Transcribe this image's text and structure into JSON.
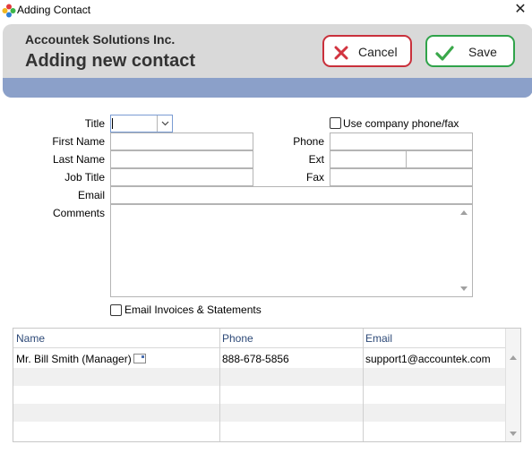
{
  "window": {
    "title": "Adding Contact",
    "close_glyph": "✕",
    "icon": "pinwheel-app-icon"
  },
  "header": {
    "company": "Accountek Solutions Inc.",
    "title": "Adding new contact",
    "cancel_label": "Cancel",
    "save_label": "Save",
    "cancel_color": "#c9303b",
    "save_color": "#2fa34a",
    "strip_color": "#8ba0c9"
  },
  "form": {
    "title_label": "Title",
    "title_value": "",
    "first_name_label": "First Name",
    "first_name_value": "",
    "last_name_label": "Last Name",
    "last_name_value": "",
    "job_title_label": "Job Title",
    "job_title_value": "",
    "email_label": "Email",
    "email_value": "",
    "comments_label": "Comments",
    "comments_value": "",
    "use_company_label": "Use company phone/fax",
    "use_company_checked": false,
    "phone_label": "Phone",
    "phone_value": "",
    "ext_label": "Ext",
    "ext_value": "",
    "ext_value_2": "",
    "fax_label": "Fax",
    "fax_value": "",
    "email_invoices_label": "Email Invoices & Statements",
    "email_invoices_checked": false
  },
  "contacts_table": {
    "columns": [
      "Name",
      "Phone",
      "Email"
    ],
    "rows": [
      {
        "name": "Mr. Bill Smith (Manager)",
        "phone": "888-678-5856",
        "email": "support1@accountek.com"
      }
    ]
  }
}
